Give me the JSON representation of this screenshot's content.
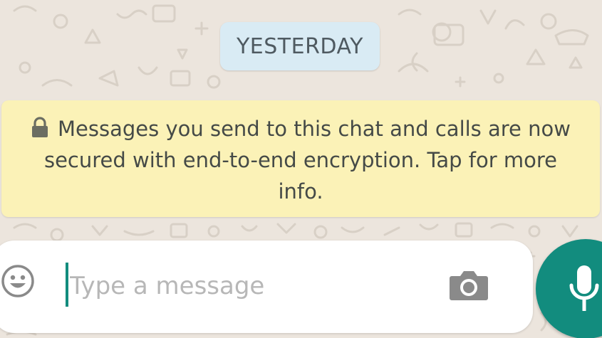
{
  "chat": {
    "date_label": "YESTERDAY",
    "encryption_notice": "Messages you send to this chat and calls are now secured with end-to-end encryption. Tap for more info."
  },
  "composer": {
    "placeholder": "Type a message",
    "value": ""
  },
  "icons": {
    "lock": "lock-icon",
    "emoji": "smiley-icon",
    "camera": "camera-icon",
    "mic": "microphone-icon"
  },
  "colors": {
    "wallpaper": "#ece5dd",
    "date_chip": "#d9ebf4",
    "notice": "#fbf2b7",
    "accent": "#128c7e"
  }
}
